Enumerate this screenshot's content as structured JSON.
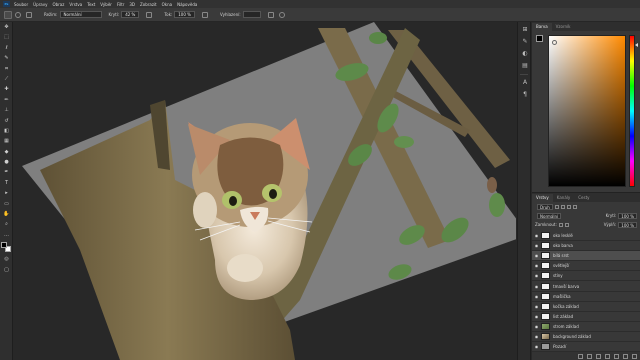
{
  "menu": {
    "logo": "Ps",
    "items": [
      "Soubor",
      "Úpravy",
      "Obraz",
      "Vrstva",
      "Text",
      "Výběr",
      "Filtr",
      "3D",
      "Zobrazit",
      "Okna",
      "Nápověda"
    ]
  },
  "options": {
    "mode_label": "Režim:",
    "mode_value": "Normální",
    "opacity_label": "Krytí:",
    "opacity_value": "42 %",
    "flow_label": "Tok:",
    "flow_value": "100 %",
    "smoothing_label": "Vyhlazení:"
  },
  "color_panel": {
    "tabs": [
      "Barva",
      "Vzorník"
    ],
    "fg": "#000000",
    "bg": "#ffffff",
    "hue": "#ff8a00"
  },
  "layers_panel": {
    "tabs": [
      "Vrstvy",
      "Kanály",
      "Cesty"
    ],
    "filter_label": "Druh",
    "blend_value": "Normální",
    "opacity_label": "Krytí:",
    "opacity_value": "100 %",
    "lock_label": "Zamknout:",
    "fill_label": "Výplň:",
    "fill_value": "100 %",
    "layers": [
      {
        "name": "oko lesklé",
        "thumb": "white",
        "selected": false
      },
      {
        "name": "oko barva",
        "thumb": "white",
        "selected": false
      },
      {
        "name": "bílá srst",
        "thumb": "white",
        "selected": true
      },
      {
        "name": "světlejší",
        "thumb": "white",
        "selected": false
      },
      {
        "name": "stíny",
        "thumb": "white",
        "selected": false
      },
      {
        "name": "tmavší barva",
        "thumb": "white",
        "selected": false
      },
      {
        "name": "mašlička",
        "thumb": "white",
        "selected": false
      },
      {
        "name": "kočka základ",
        "thumb": "white",
        "selected": false
      },
      {
        "name": "list základ",
        "thumb": "white",
        "selected": false
      },
      {
        "name": "strom základ",
        "thumb": "green",
        "selected": false
      },
      {
        "name": "background základ",
        "thumb": "pic",
        "selected": false
      },
      {
        "name": "Pozadí",
        "thumb": "gray",
        "selected": false
      }
    ]
  }
}
